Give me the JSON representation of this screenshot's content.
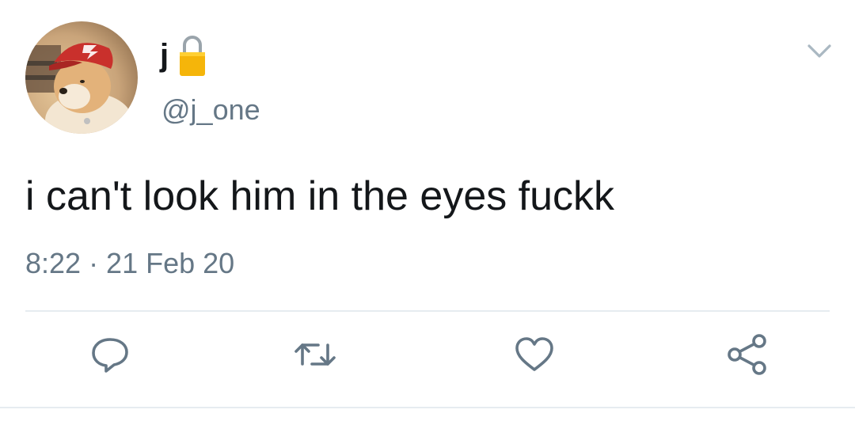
{
  "tweet": {
    "display_name": "j",
    "handle": "@j_one",
    "text": "i can't look him in the eyes fuckk",
    "timestamp": "8:22 · 21 Feb 20"
  },
  "icons": {
    "avatar": "avatar",
    "protected": "lock-icon",
    "menu": "chevron-down-icon",
    "reply": "reply-icon",
    "retweet": "retweet-icon",
    "like": "heart-icon",
    "share": "share-icon"
  },
  "colors": {
    "text_primary": "#14171a",
    "text_secondary": "#657786",
    "icon_gray": "#657786",
    "divider": "#e6ecf0",
    "lock_gold": "#f5b50a"
  }
}
